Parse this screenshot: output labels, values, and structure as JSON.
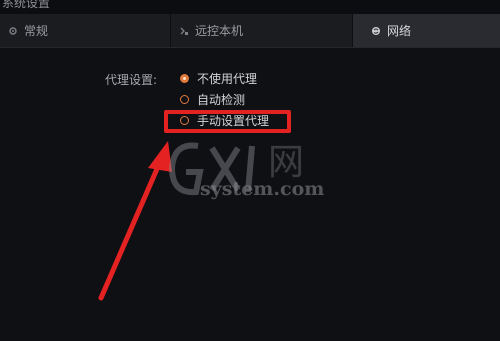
{
  "window": {
    "title": "系统设置"
  },
  "tabs": [
    {
      "label": "常规",
      "icon": "gear-icon"
    },
    {
      "label": "远控本机",
      "icon": "remote-icon"
    },
    {
      "label": "网络",
      "icon": "globe-icon",
      "active": true
    }
  ],
  "proxy": {
    "label": "代理设置:",
    "options": [
      {
        "label": "不使用代理",
        "selected": true
      },
      {
        "label": "自动检测",
        "selected": false
      },
      {
        "label": "手动设置代理",
        "selected": false
      }
    ]
  },
  "annotation": {
    "highlight_color": "#e52222"
  },
  "watermark": {
    "logo_letters": "GXI",
    "net_text": "网",
    "site_text": "system.com"
  },
  "colors": {
    "accent": "#e07b3c",
    "background": "#0f1014",
    "tabbar": "#1b1c20",
    "active_tab": "#2a2b30"
  }
}
